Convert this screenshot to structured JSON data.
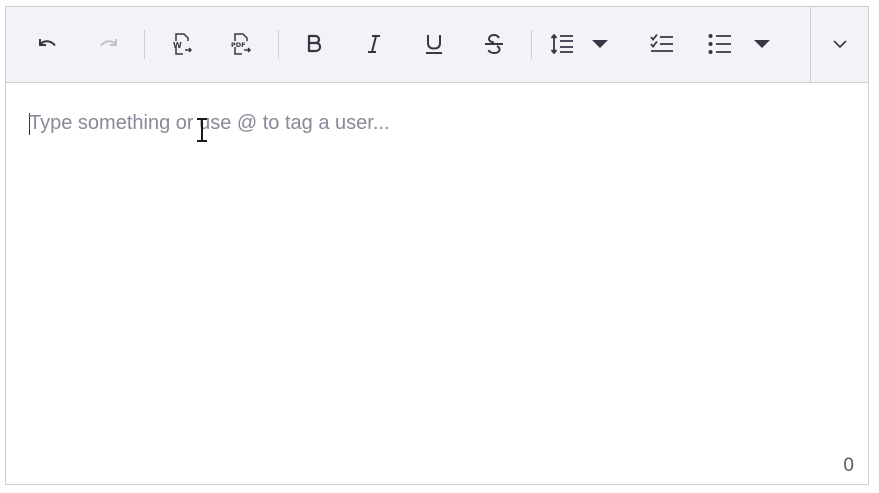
{
  "toolbar": {
    "buttons": [
      {
        "name": "undo",
        "icon": "undo-icon",
        "enabled": true
      },
      {
        "name": "redo",
        "icon": "redo-icon",
        "enabled": false
      },
      {
        "name": "import-word",
        "icon": "import-word-icon",
        "enabled": true
      },
      {
        "name": "export-pdf",
        "icon": "export-pdf-icon",
        "enabled": true
      },
      {
        "name": "bold",
        "icon": "bold-icon",
        "enabled": true
      },
      {
        "name": "italic",
        "icon": "italic-icon",
        "enabled": true
      },
      {
        "name": "underline",
        "icon": "underline-icon",
        "enabled": true
      },
      {
        "name": "strikethrough",
        "icon": "strikethrough-icon",
        "enabled": true
      },
      {
        "name": "line-height",
        "icon": "line-height-icon",
        "enabled": true
      },
      {
        "name": "checklist",
        "icon": "checklist-icon",
        "enabled": true
      },
      {
        "name": "bulleted-list",
        "icon": "bulleted-list-icon",
        "enabled": true
      },
      {
        "name": "more",
        "icon": "chevron-down-icon",
        "enabled": true
      }
    ]
  },
  "editor": {
    "placeholder": "Type something or use @ to tag a user...",
    "character_count": "0"
  },
  "colors": {
    "toolbar_bg": "#f3f2f7",
    "icon": "#3a3545",
    "icon_disabled": "#c4c1ca",
    "placeholder": "#8c8796",
    "border": "#cfcdd4"
  }
}
